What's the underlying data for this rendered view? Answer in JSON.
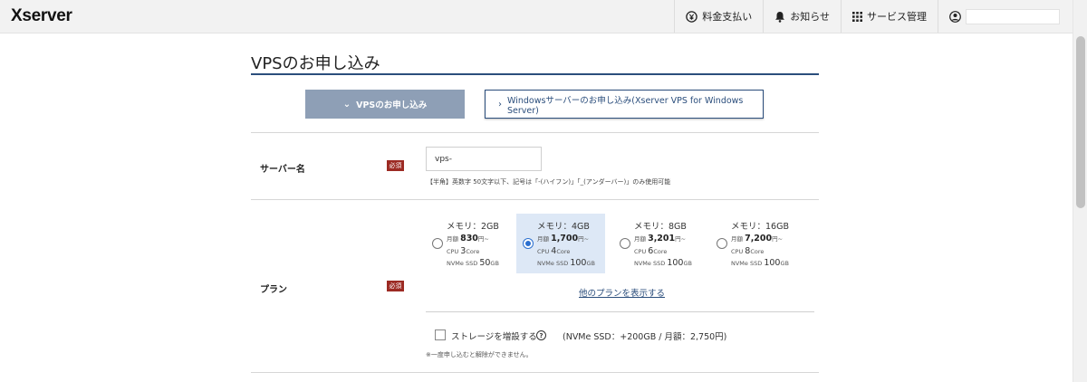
{
  "header": {
    "logo": "Xserver",
    "nav": [
      {
        "label": "料金支払い",
        "icon": "yen-coin-icon"
      },
      {
        "label": "お知らせ",
        "icon": "bell-icon"
      },
      {
        "label": "サービス管理",
        "icon": "grid-icon"
      }
    ],
    "user_icon": "user-circle-icon"
  },
  "page": {
    "title": "VPSのお申し込み",
    "tabs": [
      {
        "label": "VPSのお申し込み",
        "active": true
      },
      {
        "label": "Windowsサーバーのお申し込み(Xserver VPS for Windows Server)",
        "active": false
      }
    ]
  },
  "server_name": {
    "label": "サーバー名",
    "required": "必須",
    "value": "vps-",
    "hint": "【半角】英数字 50文字以下、記号は「-(ハイフン)」「_(アンダーバー)」のみ使用可能"
  },
  "plan": {
    "label": "プラン",
    "required": "必須",
    "cpu_label": "CPU",
    "ssd_label": "NVMe SSD",
    "monthly_label": "月額",
    "unit_yen": "円~",
    "unit_core": "Core",
    "options": [
      {
        "memory": "メモリ：2GB",
        "price": "830",
        "cpu": "3",
        "ssd": "50",
        "ssd_unit": "GB",
        "selected": false
      },
      {
        "memory": "メモリ：4GB",
        "price": "1,700",
        "cpu": "4",
        "ssd": "100",
        "ssd_unit": "GB",
        "selected": true
      },
      {
        "memory": "メモリ：8GB",
        "price": "3,201",
        "cpu": "6",
        "ssd": "100",
        "ssd_unit": "GB",
        "selected": false
      },
      {
        "memory": "メモリ：16GB",
        "price": "7,200",
        "cpu": "8",
        "ssd": "100",
        "ssd_unit": "GB",
        "selected": false
      }
    ],
    "more_link": "他のプランを表示する",
    "storage_checkbox": "ストレージを増設する",
    "storage_help": "?",
    "storage_note": "(NVMe SSD：+200GB / 月額：2,750円)",
    "cancel_note": "※一度申し込むと解除ができません。"
  },
  "colors": {
    "accent": "#2b4e7c",
    "tab_active_bg": "#8e9fb6",
    "required_badge": "#9c2a23",
    "selected_plan_bg": "#dde8f6",
    "radio_on": "#2b6fcf"
  }
}
